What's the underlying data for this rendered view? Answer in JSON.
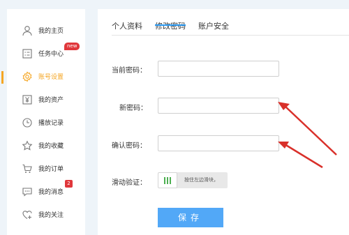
{
  "sidebar": {
    "items": [
      {
        "label": "我的主页",
        "icon": "user-icon"
      },
      {
        "label": "任务中心",
        "icon": "task-list-icon",
        "badge": "new"
      },
      {
        "label": "账号设置",
        "icon": "gear-icon",
        "active": true
      },
      {
        "label": "我的资产",
        "icon": "yen-icon"
      },
      {
        "label": "播放记录",
        "icon": "clock-icon"
      },
      {
        "label": "我的收藏",
        "icon": "star-icon"
      },
      {
        "label": "我的订单",
        "icon": "cart-icon"
      },
      {
        "label": "我的消息",
        "icon": "message-icon",
        "badge": "2"
      },
      {
        "label": "我的关注",
        "icon": "heart-plus-icon"
      }
    ]
  },
  "tabs": [
    {
      "label": "个人资料"
    },
    {
      "label": "修改密码",
      "active": true
    },
    {
      "label": "账户安全"
    }
  ],
  "form": {
    "current_password_label": "当前密码：",
    "new_password_label": "新密码：",
    "confirm_password_label": "确认密码：",
    "slider_label": "滑动验证：",
    "slider_hint": "按住左边滑块，",
    "save_label": "保存"
  },
  "colors": {
    "accent_orange": "#f5a623",
    "tab_blue": "#2b9bf4",
    "button_blue": "#52a8f7",
    "badge_red": "#e0373b",
    "slider_grip_green": "#4caf50",
    "annotation_arrow_red": "#d9302a"
  }
}
